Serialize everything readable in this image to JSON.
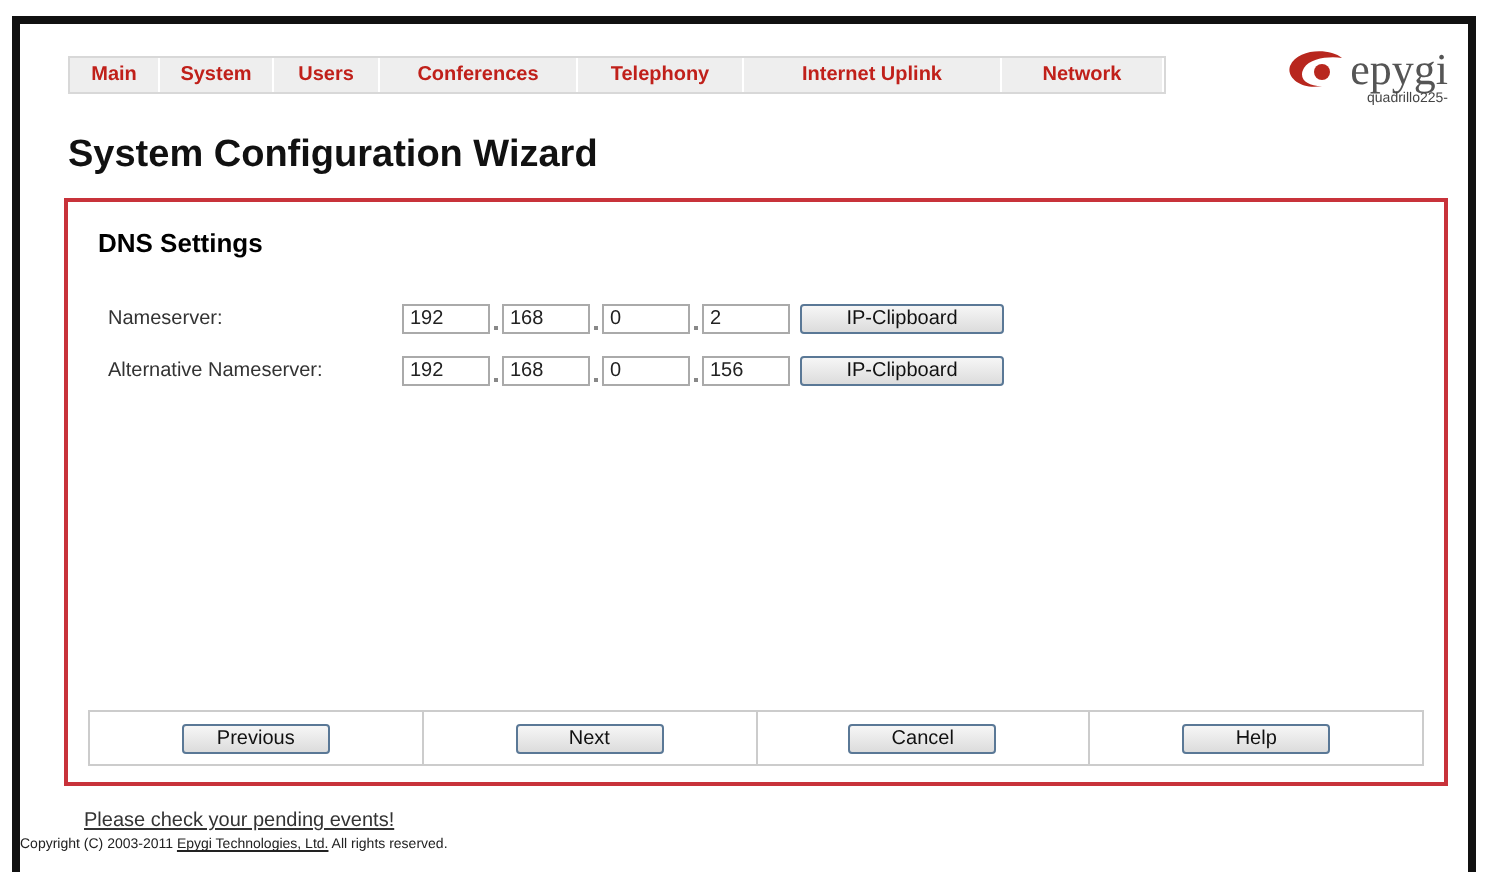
{
  "nav": [
    {
      "label": "Main"
    },
    {
      "label": "System"
    },
    {
      "label": "Users"
    },
    {
      "label": "Conferences"
    },
    {
      "label": "Telephony"
    },
    {
      "label": "Internet Uplink"
    },
    {
      "label": "Network"
    }
  ],
  "logo": {
    "brand": "epygi",
    "model": "quadrillo225-"
  },
  "title": "System Configuration Wizard",
  "panel": {
    "heading": "DNS Settings",
    "rows": [
      {
        "label": "Nameserver:",
        "octets": [
          "192",
          "168",
          "0",
          "2"
        ],
        "button": "IP-Clipboard"
      },
      {
        "label": "Alternative Nameserver:",
        "octets": [
          "192",
          "168",
          "0",
          "156"
        ],
        "button": "IP-Clipboard"
      }
    ],
    "buttons": [
      "Previous",
      "Next",
      "Cancel",
      "Help"
    ]
  },
  "footer": {
    "events_link": "Please check your pending events!",
    "copyright_before": "Copyright (C) 2003-2011",
    "copyright_link": "Epygi Technologies, Ltd.",
    "copyright_after": "All rights reserved."
  }
}
